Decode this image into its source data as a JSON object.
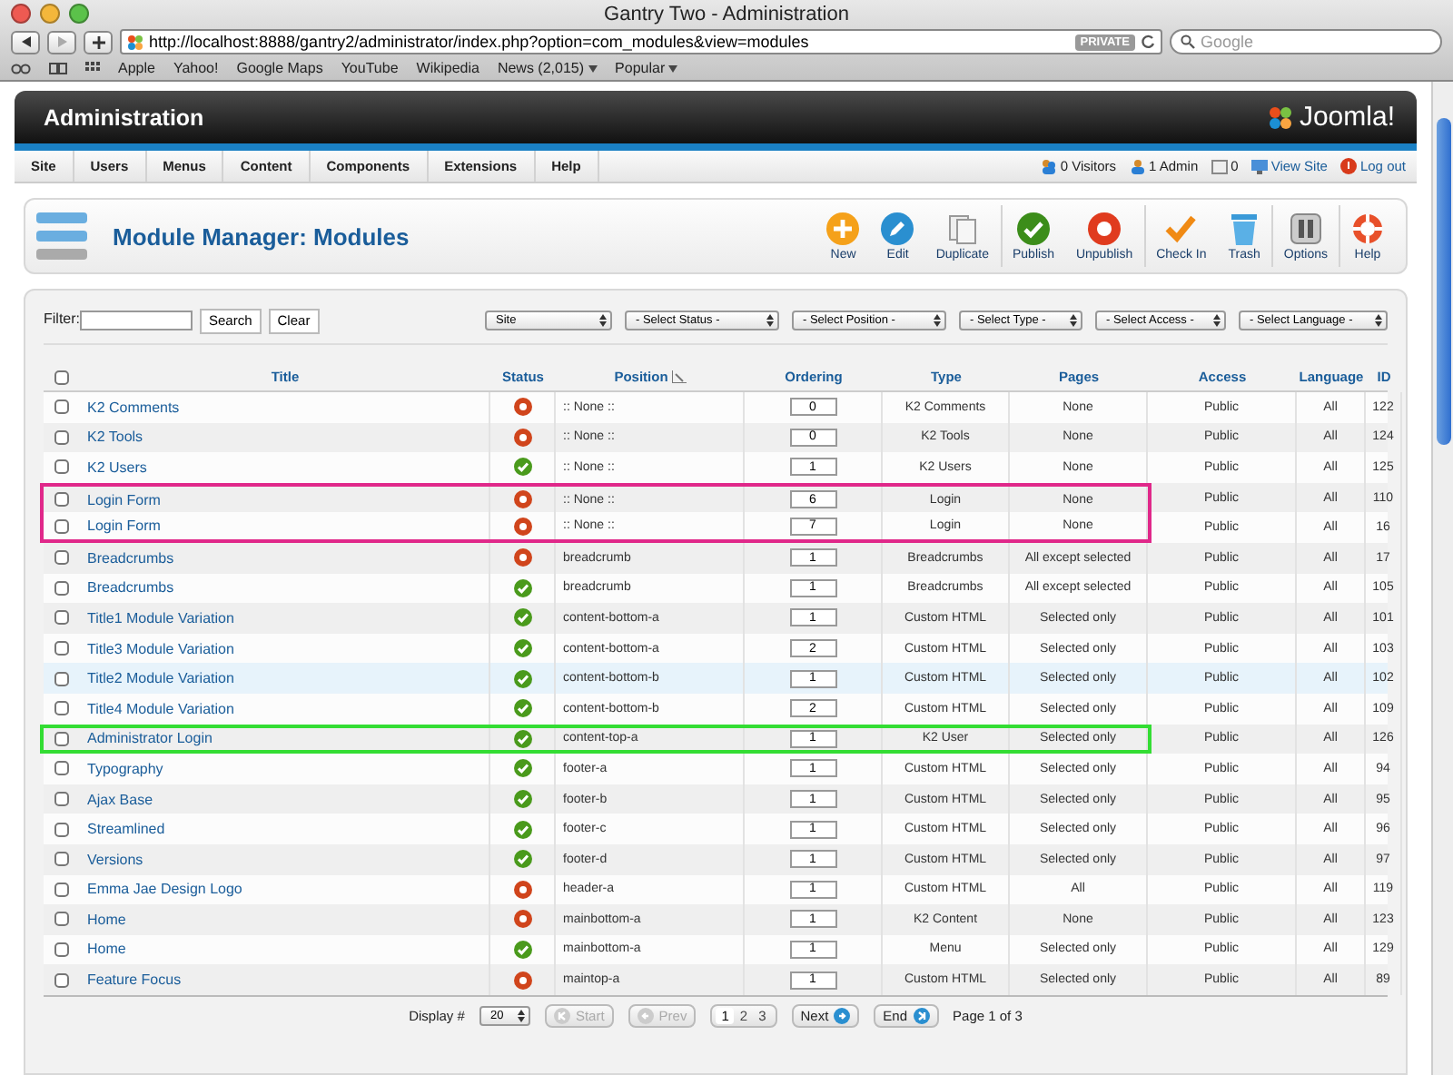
{
  "window": {
    "title": "Gantry Two - Administration"
  },
  "browser": {
    "url": "http://localhost:8888/gantry2/administrator/index.php?option=com_modules&view=modules",
    "private_badge": "PRIVATE",
    "search_placeholder": "Google",
    "bookmarks": [
      {
        "label": "Apple",
        "menu": false
      },
      {
        "label": "Yahoo!",
        "menu": false
      },
      {
        "label": "Google Maps",
        "menu": false
      },
      {
        "label": "YouTube",
        "menu": false
      },
      {
        "label": "Wikipedia",
        "menu": false
      },
      {
        "label": "News (2,015)",
        "menu": true
      },
      {
        "label": "Popular",
        "menu": true
      }
    ]
  },
  "header": {
    "title": "Administration",
    "logo": "Joomla!"
  },
  "menu": {
    "items": [
      "Site",
      "Users",
      "Menus",
      "Content",
      "Components",
      "Extensions",
      "Help"
    ],
    "status": [
      {
        "kind": "visitors",
        "label": "0 Visitors"
      },
      {
        "kind": "admins",
        "label": "1 Admin"
      },
      {
        "kind": "messages",
        "label": "0"
      },
      {
        "kind": "view",
        "label": "View Site"
      },
      {
        "kind": "logout",
        "label": "Log out"
      }
    ]
  },
  "toolbar": {
    "title": "Module Manager: Modules",
    "buttons": [
      {
        "kind": "new",
        "label": "New"
      },
      {
        "kind": "edit",
        "label": "Edit"
      },
      {
        "kind": "duplicate",
        "label": "Duplicate"
      },
      {
        "kind": "publish",
        "label": "Publish"
      },
      {
        "kind": "unpublish",
        "label": "Unpublish"
      },
      {
        "kind": "checkin",
        "label": "Check In"
      },
      {
        "kind": "trash",
        "label": "Trash"
      },
      {
        "kind": "options",
        "label": "Options"
      },
      {
        "kind": "help",
        "label": "Help"
      }
    ]
  },
  "filter": {
    "label": "Filter:",
    "search_button": "Search",
    "clear_button": "Clear",
    "selects": [
      "Site",
      "- Select Status -",
      "- Select Position -",
      "- Select Type -",
      "- Select Access -",
      "- Select Language -"
    ]
  },
  "table": {
    "select_all_checked": false,
    "columns": [
      "Title",
      "Status",
      "Position",
      "Ordering",
      "Type",
      "Pages",
      "Access",
      "Language",
      "ID"
    ],
    "rows": [
      {
        "title": "K2 Comments",
        "published": false,
        "position": ":: None ::",
        "ordering": "0",
        "type": "K2 Comments",
        "pages": "None",
        "access": "Public",
        "language": "All",
        "id": "122",
        "hover": false
      },
      {
        "title": "K2 Tools",
        "published": false,
        "position": ":: None ::",
        "ordering": "0",
        "type": "K2 Tools",
        "pages": "None",
        "access": "Public",
        "language": "All",
        "id": "124",
        "hover": false
      },
      {
        "title": "K2 Users",
        "published": true,
        "position": ":: None ::",
        "ordering": "1",
        "type": "K2 Users",
        "pages": "None",
        "access": "Public",
        "language": "All",
        "id": "125",
        "hover": false
      },
      {
        "title": "Login Form",
        "published": false,
        "position": ":: None ::",
        "ordering": "6",
        "type": "Login",
        "pages": "None",
        "access": "Public",
        "language": "All",
        "id": "110",
        "hover": false,
        "color": "#e0288a"
      },
      {
        "title": "Login Form",
        "published": false,
        "position": ":: None ::",
        "ordering": "7",
        "type": "Login",
        "pages": "None",
        "access": "Public",
        "language": "All",
        "id": "16",
        "hover": false,
        "color": "#e0288a"
      },
      {
        "title": "Breadcrumbs",
        "published": false,
        "position": "breadcrumb",
        "ordering": "1",
        "type": "Breadcrumbs",
        "pages": "All except selected",
        "access": "Public",
        "language": "All",
        "id": "17",
        "hover": false
      },
      {
        "title": "Breadcrumbs",
        "published": true,
        "position": "breadcrumb",
        "ordering": "1",
        "type": "Breadcrumbs",
        "pages": "All except selected",
        "access": "Public",
        "language": "All",
        "id": "105",
        "hover": false
      },
      {
        "title": "Title1 Module Variation",
        "published": true,
        "position": "content-bottom-a",
        "ordering": "1",
        "type": "Custom HTML",
        "pages": "Selected only",
        "access": "Public",
        "language": "All",
        "id": "101",
        "hover": false
      },
      {
        "title": "Title3 Module Variation",
        "published": true,
        "position": "content-bottom-a",
        "ordering": "2",
        "type": "Custom HTML",
        "pages": "Selected only",
        "access": "Public",
        "language": "All",
        "id": "103",
        "hover": false
      },
      {
        "title": "Title2 Module Variation",
        "published": true,
        "position": "content-bottom-b",
        "ordering": "1",
        "type": "Custom HTML",
        "pages": "Selected only",
        "access": "Public",
        "language": "All",
        "id": "102",
        "hover": true
      },
      {
        "title": "Title4 Module Variation",
        "published": true,
        "position": "content-bottom-b",
        "ordering": "2",
        "type": "Custom HTML",
        "pages": "Selected only",
        "access": "Public",
        "language": "All",
        "id": "109",
        "hover": false
      },
      {
        "title": "Administrator Login",
        "published": true,
        "position": "content-top-a",
        "ordering": "1",
        "type": "K2 User",
        "pages": "Selected only",
        "access": "Public",
        "language": "All",
        "id": "126",
        "hover": false,
        "color": "#33dd33"
      },
      {
        "title": "Typography",
        "published": true,
        "position": "footer-a",
        "ordering": "1",
        "type": "Custom HTML",
        "pages": "Selected only",
        "access": "Public",
        "language": "All",
        "id": "94",
        "hover": false
      },
      {
        "title": "Ajax Base",
        "published": true,
        "position": "footer-b",
        "ordering": "1",
        "type": "Custom HTML",
        "pages": "Selected only",
        "access": "Public",
        "language": "All",
        "id": "95",
        "hover": false
      },
      {
        "title": "Streamlined",
        "published": true,
        "position": "footer-c",
        "ordering": "1",
        "type": "Custom HTML",
        "pages": "Selected only",
        "access": "Public",
        "language": "All",
        "id": "96",
        "hover": false
      },
      {
        "title": "Versions",
        "published": true,
        "position": "footer-d",
        "ordering": "1",
        "type": "Custom HTML",
        "pages": "Selected only",
        "access": "Public",
        "language": "All",
        "id": "97",
        "hover": false
      },
      {
        "title": "Emma Jae Design Logo",
        "published": false,
        "position": "header-a",
        "ordering": "1",
        "type": "Custom HTML",
        "pages": "All",
        "access": "Public",
        "language": "All",
        "id": "119",
        "hover": false
      },
      {
        "title": "Home",
        "published": false,
        "position": "mainbottom-a",
        "ordering": "1",
        "type": "K2 Content",
        "pages": "None",
        "access": "Public",
        "language": "All",
        "id": "123",
        "hover": false
      },
      {
        "title": "Home",
        "published": true,
        "position": "mainbottom-a",
        "ordering": "1",
        "type": "Menu",
        "pages": "Selected only",
        "access": "Public",
        "language": "All",
        "id": "129",
        "hover": false
      },
      {
        "title": "Feature Focus",
        "published": false,
        "position": "maintop-a",
        "ordering": "1",
        "type": "Custom HTML",
        "pages": "Selected only",
        "access": "Public",
        "language": "All",
        "id": "89",
        "hover": false
      }
    ]
  },
  "pagination": {
    "display_label": "Display #",
    "display_value": "20",
    "buttons": [
      {
        "kind": "start",
        "label": "Start",
        "disabled": true
      },
      {
        "kind": "prev",
        "label": "Prev",
        "disabled": true
      }
    ],
    "pages": [
      {
        "label": "1",
        "selected": true
      },
      {
        "label": "2",
        "selected": false
      },
      {
        "label": "3",
        "selected": false
      }
    ],
    "next": [
      {
        "kind": "next",
        "label": "Next"
      },
      {
        "kind": "end",
        "label": "End"
      }
    ],
    "summary": "Page 1 of 3"
  }
}
